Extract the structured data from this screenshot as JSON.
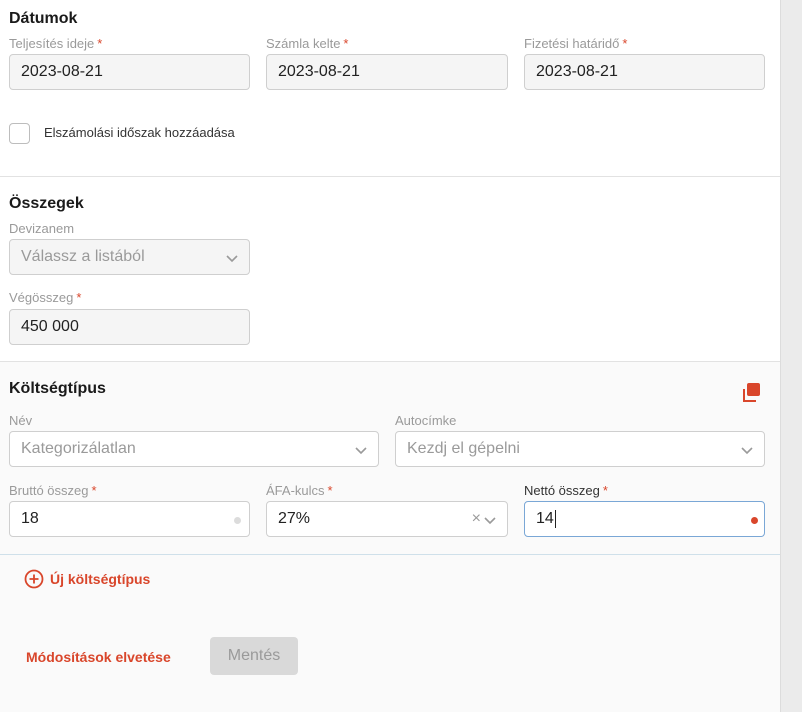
{
  "dates": {
    "title": "Dátumok",
    "fulfillment": {
      "label": "Teljesítés ideje",
      "value": "2023-08-21"
    },
    "invoice_date": {
      "label": "Számla kelte",
      "value": "2023-08-21"
    },
    "due_date": {
      "label": "Fizetési határidő",
      "value": "2023-08-21"
    },
    "required_mark": "*",
    "period_checkbox_label": "Elszámolási időszak hozzáadása"
  },
  "amounts": {
    "title": "Összegek",
    "currency": {
      "label": "Devizanem",
      "placeholder": "Válassz a listából"
    },
    "total": {
      "label": "Végösszeg",
      "value": "450 000"
    }
  },
  "cost_type": {
    "title": "Költségtípus",
    "name": {
      "label": "Név",
      "value": "Kategorizálatlan"
    },
    "autotag": {
      "label": "Autocímke",
      "placeholder": "Kezdj el gépelni"
    },
    "gross": {
      "label": "Bruttó összeg",
      "value": "18"
    },
    "vat": {
      "label": "ÁFA-kulcs",
      "value": "27%",
      "clear": "×"
    },
    "net": {
      "label": "Nettó összeg",
      "value": "14"
    }
  },
  "actions": {
    "add_cost_type": "Új költségtípus",
    "discard": "Módosítások elvetése",
    "save": "Mentés"
  },
  "colors": {
    "accent": "#d9462b",
    "focus": "#7aa7d6"
  }
}
